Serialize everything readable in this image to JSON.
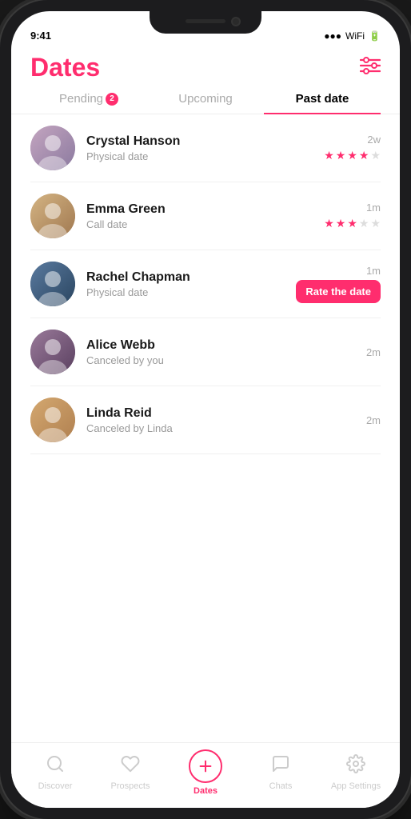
{
  "app": {
    "title": "Dates",
    "filter_icon": "⚙"
  },
  "tabs": [
    {
      "id": "pending",
      "label": "Pending",
      "badge": 2,
      "active": false
    },
    {
      "id": "upcoming",
      "label": "Upcoming",
      "badge": null,
      "active": false
    },
    {
      "id": "past_date",
      "label": "Past date",
      "badge": null,
      "active": true
    }
  ],
  "dates": [
    {
      "id": 1,
      "name": "Crystal Hanson",
      "type": "Physical date",
      "time": "2w",
      "rating": 4,
      "max_rating": 5,
      "has_rate_btn": false,
      "avatar_class": "avatar-crystal",
      "avatar_emoji": "👩"
    },
    {
      "id": 2,
      "name": "Emma Green",
      "type": "Call date",
      "time": "1m",
      "rating": 3,
      "max_rating": 5,
      "has_rate_btn": false,
      "avatar_class": "avatar-emma",
      "avatar_emoji": "👩"
    },
    {
      "id": 3,
      "name": "Rachel Chapman",
      "type": "Physical date",
      "time": "1m",
      "rating": null,
      "has_rate_btn": true,
      "rate_btn_label": "Rate the date",
      "avatar_class": "avatar-rachel",
      "avatar_emoji": "👩"
    },
    {
      "id": 4,
      "name": "Alice Webb",
      "type": "Canceled by you",
      "time": "2m",
      "rating": null,
      "has_rate_btn": false,
      "avatar_class": "avatar-alice",
      "avatar_emoji": "👩"
    },
    {
      "id": 5,
      "name": "Linda Reid",
      "type": "Canceled by Linda",
      "time": "2m",
      "rating": null,
      "has_rate_btn": false,
      "avatar_class": "avatar-linda",
      "avatar_emoji": "👩"
    }
  ],
  "nav": {
    "items": [
      {
        "id": "discover",
        "label": "Discover",
        "icon": "search",
        "active": false
      },
      {
        "id": "prospects",
        "label": "Prospects",
        "icon": "heart",
        "active": false
      },
      {
        "id": "dates",
        "label": "Dates",
        "icon": "plus-circle",
        "active": true
      },
      {
        "id": "chats",
        "label": "Chats",
        "icon": "chat",
        "active": false
      },
      {
        "id": "app_settings",
        "label": "App Settings",
        "icon": "gear",
        "active": false
      }
    ]
  }
}
